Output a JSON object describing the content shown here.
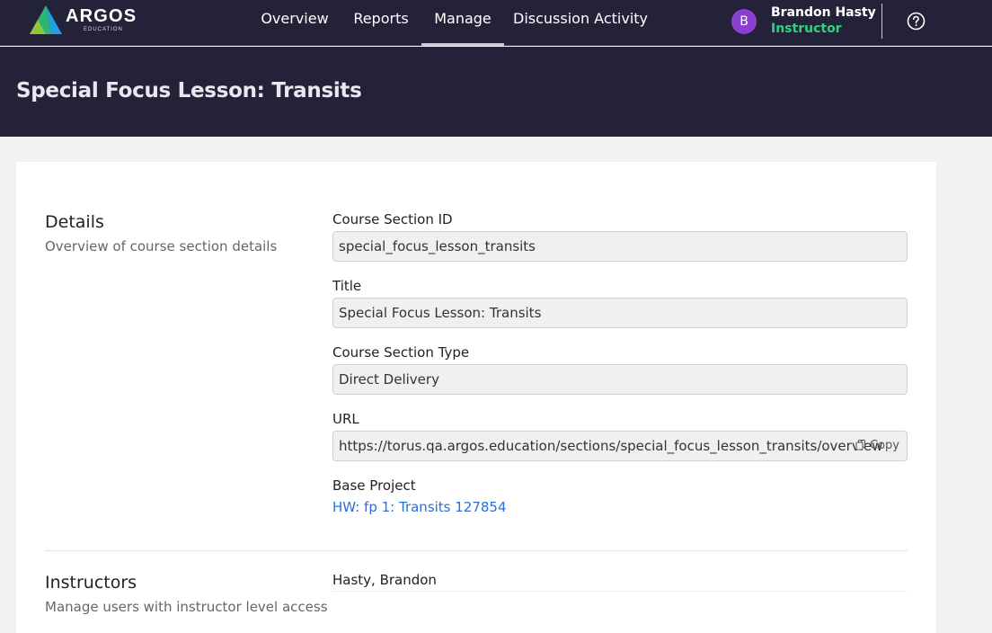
{
  "brand": {
    "name": "ARGOS",
    "sub": "EDUCATION",
    "colors": [
      "#2bb673",
      "#1fa0e0",
      "#8dc63f"
    ]
  },
  "nav": {
    "items": [
      {
        "label": "Overview",
        "active": false
      },
      {
        "label": "Reports",
        "active": false
      },
      {
        "label": "Manage",
        "active": true
      },
      {
        "label": "Discussion Activity",
        "active": false
      }
    ]
  },
  "user": {
    "initial": "B",
    "name": "Brandon Hasty",
    "role": "Instructor"
  },
  "page": {
    "title": "Special Focus Lesson: Transits"
  },
  "details": {
    "title": "Details",
    "description": "Overview of course section details",
    "fields": {
      "section_id": {
        "label": "Course Section ID",
        "value": "special_focus_lesson_transits"
      },
      "title": {
        "label": "Title",
        "value": "Special Focus Lesson: Transits"
      },
      "type": {
        "label": "Course Section Type",
        "value": "Direct Delivery"
      },
      "url": {
        "label": "URL",
        "value": "https://torus.qa.argos.education/sections/special_focus_lesson_transits/overview",
        "copy_label": "Copy"
      }
    },
    "base_project": {
      "label": "Base Project",
      "value": "HW: fp 1: Transits 127854"
    }
  },
  "instructors": {
    "title": "Instructors",
    "description": "Manage users with instructor level access",
    "list": [
      "Hasty, Brandon"
    ]
  },
  "colors": {
    "nav_bg": "#232238",
    "link": "#2a6fd6",
    "role": "#2bd47e",
    "avatar": "#8a3fd1"
  }
}
